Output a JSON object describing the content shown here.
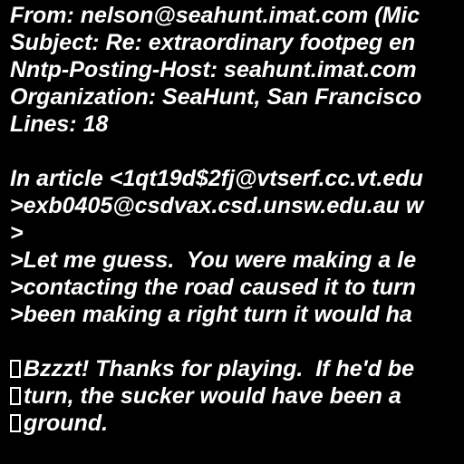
{
  "header": {
    "from": "From: nelson@seahunt.imat.com (Mic",
    "subject": "Subject: Re: extraordinary footpeg en",
    "nntp_host": "Nntp-Posting-Host: seahunt.imat.com",
    "organization": "Organization: SeaHunt, San Francisco",
    "lines": "Lines: 18"
  },
  "body": {
    "attribution": "In article <1qt19d$2fj@vtserf.cc.vt.edu",
    "quote_1": ">exb0405@csdvax.csd.unsw.edu.au w",
    "quote_2": ">",
    "quote_3": ">Let me guess.  You were making a le",
    "quote_4": ">contacting the road caused it to turn",
    "quote_5": ">been making a right turn it would ha",
    "reply_1": "Bzzzt! Thanks for playing.  If he'd be",
    "reply_2": "turn, the sucker would have been a",
    "reply_3": "ground."
  },
  "colors": {
    "background": "#000000",
    "text": "#ffffff"
  }
}
